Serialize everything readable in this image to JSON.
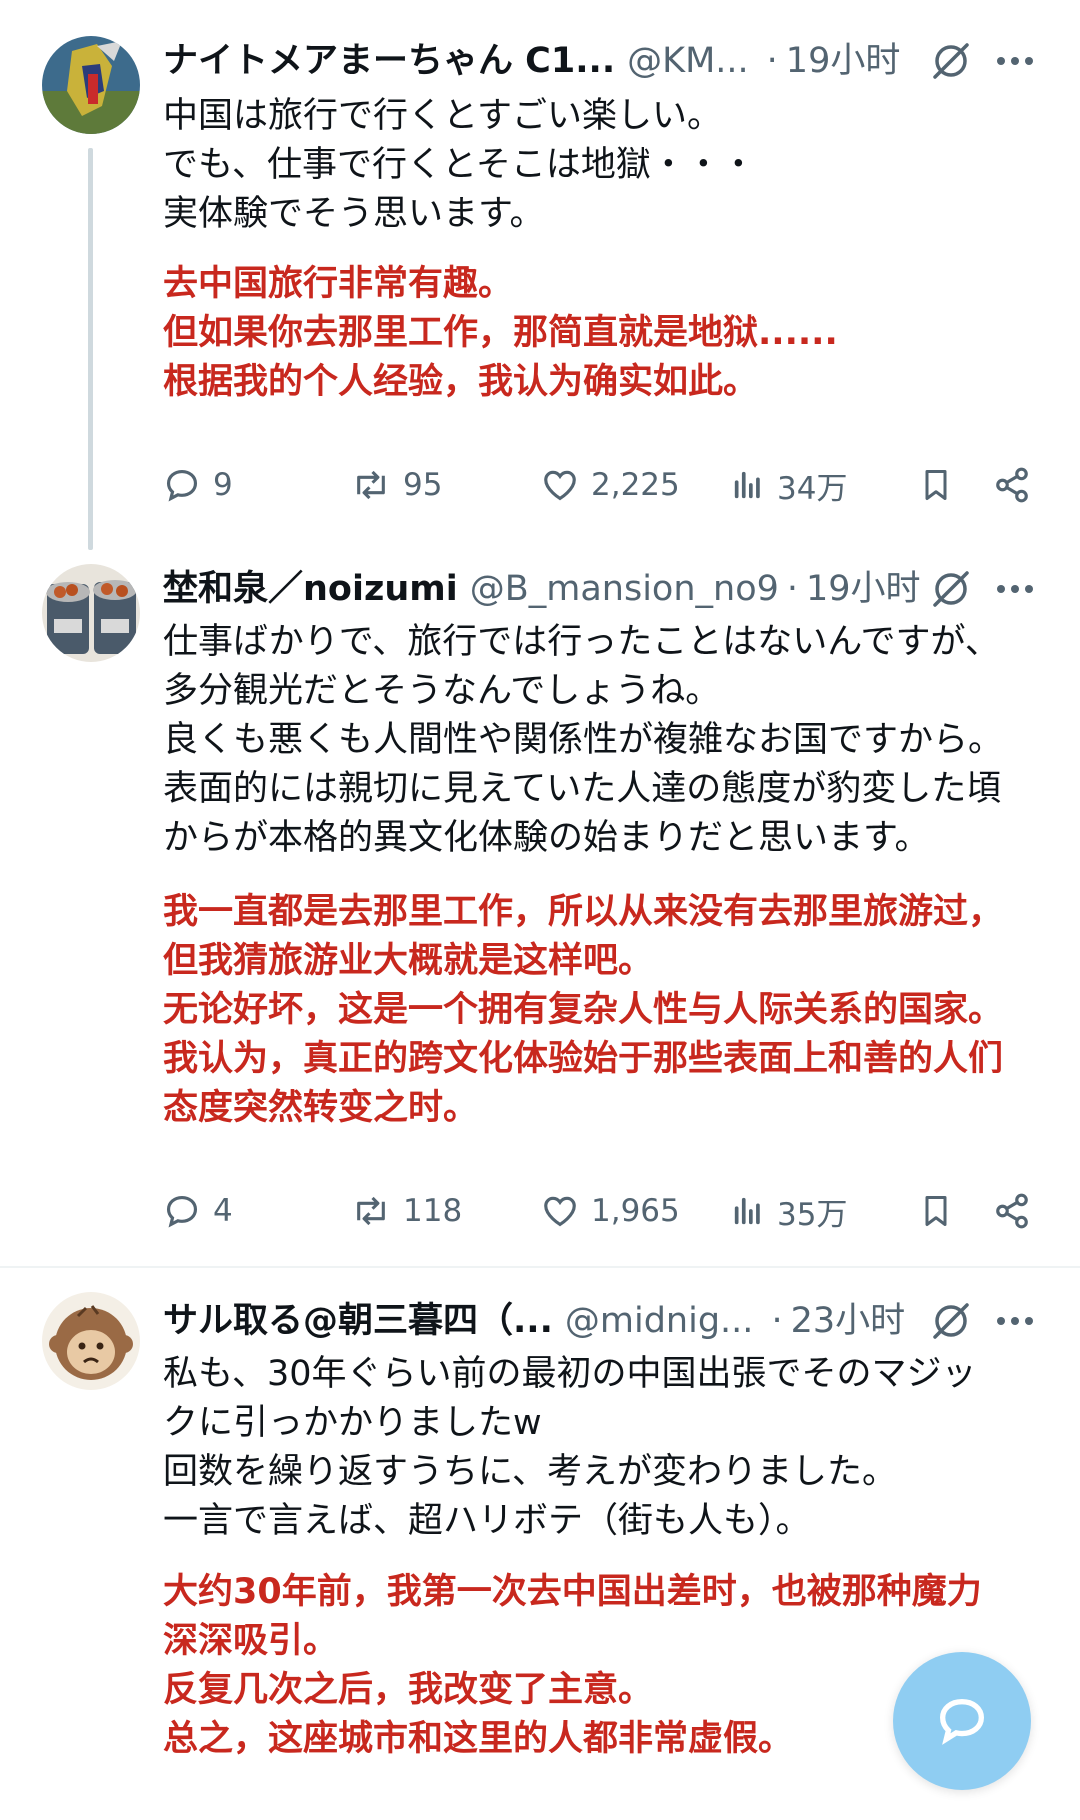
{
  "posts": [
    {
      "name": "ナイトメアまーちゃん C1...",
      "handle": "@KM...",
      "time": "19小时",
      "text_ja": "中国は旅行で行くとすごい楽しい。\nでも、仕事で行くとそこは地獄・・・\n実体験でそう思います。",
      "text_zh": "去中国旅行非常有趣。\n但如果你去那里工作，那简直就是地狱......\n根据我的个人经验，我认为确实如此。",
      "replies": "9",
      "reposts": "95",
      "likes": "2,225",
      "views": "34万"
    },
    {
      "name": "埜和泉／noizumi",
      "handle": "@B_mansion_no9",
      "time": "19小时",
      "text_ja": "仕事ばかりで、旅行では行ったことはないんですが、\n多分観光だとそうなんでしょうね。\n良くも悪くも人間性や関係性が複雑なお国ですから。\n表面的には親切に見えていた人達の態度が豹変した頃\nからが本格的異文化体験の始まりだと思います。",
      "text_zh": "我一直都是去那里工作，所以从来没有去那里旅游过，\n但我猜旅游业大概就是这样吧。\n无论好坏，这是一个拥有复杂人性与人际关系的国家。\n我认为，真正的跨文化体验始于那些表面上和善的人们\n态度突然转变之时。",
      "replies": "4",
      "reposts": "118",
      "likes": "1,965",
      "views": "35万"
    },
    {
      "name": "サル取る@朝三暮四（...",
      "handle": "@midnig...",
      "time": "23小时",
      "text_ja": "私も、30年ぐらい前の最初の中国出張でそのマジッ\nクに引っかかりましたw\n回数を繰り返すうちに、考えが変わりました。\n一言で言えば、超ハリボテ（街も人も）。",
      "text_zh": "大约30年前，我第一次去中国出差时，也被那种魔力\n深深吸引。\n反复几次之后，我改变了主意。\n总之，这座城市和这里的人都非常虚假。"
    }
  ],
  "icons": {
    "grok": "grok-icon",
    "more": "more-icon",
    "reply": "reply-icon",
    "repost": "repost-icon",
    "like": "like-icon",
    "views": "views-icon",
    "bookmark": "bookmark-icon",
    "share": "share-icon",
    "compose": "compose-reply-icon"
  },
  "colors": {
    "translation": "#c8281e",
    "secondary_text": "#536471",
    "fab": "#8fcdf2",
    "thread_line": "#cfd9de"
  }
}
